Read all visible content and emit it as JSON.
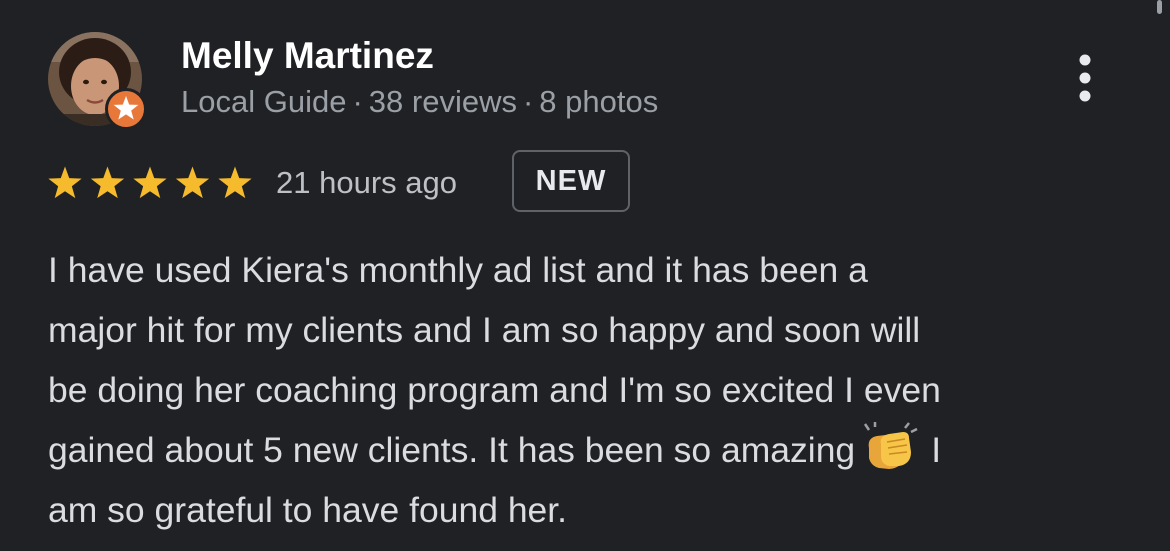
{
  "reviewer": {
    "name": "Melly Martinez",
    "role": "Local Guide",
    "meta_separator": "·",
    "reviews": "38 reviews",
    "photos": "8 photos",
    "avatar_icon": "profile-photo",
    "badge_icon": "local-guide-star-icon"
  },
  "review": {
    "rating": 5,
    "max_rating": 5,
    "time": "21 hours ago",
    "badge": "NEW",
    "text_lines": [
      "I have used Kiera's monthly ad list and it has been a",
      "major hit for my clients and I am so happy and soon will",
      "be doing her coaching program and I'm so excited I even",
      "gained about 5 new clients. It has been so amazing",
      "am so grateful to have found her."
    ],
    "line4_tail": "I",
    "emoji_icon": "clapping-hands-icon"
  },
  "actions": {
    "more_icon": "more-vertical-icon"
  },
  "colors": {
    "background": "#202124",
    "star": "#f6bb2d",
    "badge": "#e8773a",
    "muted_text": "#9aa0a6"
  }
}
